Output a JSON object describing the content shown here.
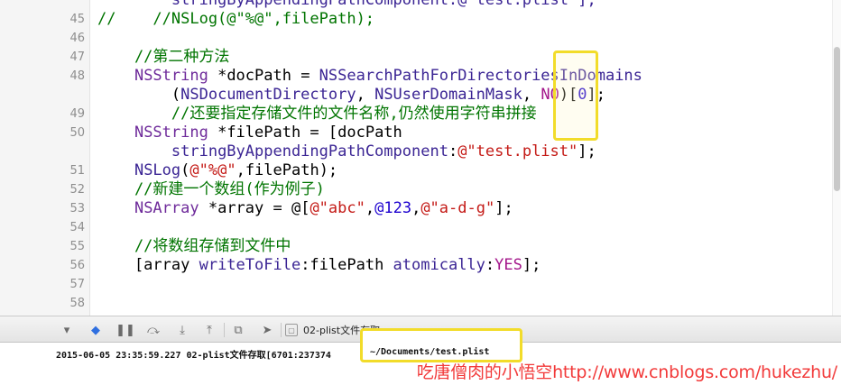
{
  "editor": {
    "lines": [
      {
        "num": "",
        "tokens": [
          {
            "t": "        stringByAppendingPathComponent:@\"test.plist\"];",
            "c": "kw-fn"
          }
        ]
      },
      {
        "num": "45",
        "tokens": [
          {
            "t": "//    //NSLog(@\"%@\",filePath);",
            "c": "kw-comment"
          }
        ]
      },
      {
        "num": "46",
        "tokens": []
      },
      {
        "num": "47",
        "tokens": [
          {
            "t": "    //第二种方法",
            "c": "kw-comment"
          }
        ]
      },
      {
        "num": "48",
        "tokens": [
          {
            "t": "    ",
            "c": "kw-plain"
          },
          {
            "t": "NSString",
            "c": "kw-type"
          },
          {
            "t": " *docPath = ",
            "c": "kw-plain"
          },
          {
            "t": "NSSearchPathForDirectoriesInDomains",
            "c": "kw-fn"
          }
        ]
      },
      {
        "num": "",
        "tokens": [
          {
            "t": "        (",
            "c": "kw-plain"
          },
          {
            "t": "NSDocumentDirectory",
            "c": "kw-fn"
          },
          {
            "t": ", ",
            "c": "kw-plain"
          },
          {
            "t": "NSUserDomainMask",
            "c": "kw-fn"
          },
          {
            "t": ", ",
            "c": "kw-plain"
          },
          {
            "t": "NO",
            "c": "kw-const"
          },
          {
            "t": ")[",
            "c": "kw-plain"
          },
          {
            "t": "0",
            "c": "kw-num"
          },
          {
            "t": "];",
            "c": "kw-plain"
          }
        ]
      },
      {
        "num": "49",
        "tokens": [
          {
            "t": "        //还要指定存储文件的文件名称,仍然使用字符串拼接",
            "c": "kw-comment"
          }
        ]
      },
      {
        "num": "50",
        "tokens": [
          {
            "t": "    ",
            "c": "kw-plain"
          },
          {
            "t": "NSString",
            "c": "kw-type"
          },
          {
            "t": " *filePath = [docPath",
            "c": "kw-plain"
          }
        ]
      },
      {
        "num": "",
        "tokens": [
          {
            "t": "        ",
            "c": "kw-plain"
          },
          {
            "t": "stringByAppendingPathComponent",
            "c": "kw-fn"
          },
          {
            "t": ":",
            "c": "kw-plain"
          },
          {
            "t": "@\"test.plist\"",
            "c": "kw-str"
          },
          {
            "t": "];",
            "c": "kw-plain"
          }
        ]
      },
      {
        "num": "51",
        "tokens": [
          {
            "t": "    ",
            "c": "kw-plain"
          },
          {
            "t": "NSLog",
            "c": "kw-fn"
          },
          {
            "t": "(",
            "c": "kw-plain"
          },
          {
            "t": "@\"%@\"",
            "c": "kw-str"
          },
          {
            "t": ",filePath);",
            "c": "kw-plain"
          }
        ]
      },
      {
        "num": "52",
        "tokens": [
          {
            "t": "    //新建一个数组(作为例子)",
            "c": "kw-comment"
          }
        ]
      },
      {
        "num": "53",
        "tokens": [
          {
            "t": "    ",
            "c": "kw-plain"
          },
          {
            "t": "NSArray",
            "c": "kw-type"
          },
          {
            "t": " *array = @[",
            "c": "kw-plain"
          },
          {
            "t": "@\"abc\"",
            "c": "kw-str"
          },
          {
            "t": ",",
            "c": "kw-plain"
          },
          {
            "t": "@123",
            "c": "kw-num"
          },
          {
            "t": ",",
            "c": "kw-plain"
          },
          {
            "t": "@\"a-d-g\"",
            "c": "kw-str"
          },
          {
            "t": "];",
            "c": "kw-plain"
          }
        ]
      },
      {
        "num": "54",
        "tokens": []
      },
      {
        "num": "55",
        "tokens": [
          {
            "t": "    //将数组存储到文件中",
            "c": "kw-comment"
          }
        ]
      },
      {
        "num": "56",
        "tokens": [
          {
            "t": "    [array ",
            "c": "kw-plain"
          },
          {
            "t": "writeToFile",
            "c": "kw-fn"
          },
          {
            "t": ":filePath ",
            "c": "kw-plain"
          },
          {
            "t": "atomically",
            "c": "kw-fn"
          },
          {
            "t": ":",
            "c": "kw-plain"
          },
          {
            "t": "YES",
            "c": "kw-const"
          },
          {
            "t": "];",
            "c": "kw-plain"
          }
        ]
      },
      {
        "num": "57",
        "tokens": []
      },
      {
        "num": "58",
        "tokens": []
      }
    ]
  },
  "toolbar": {
    "hide_console_icon": "▾",
    "breakpoint_icon": "◆",
    "pause_icon": "❚❚",
    "step_over_icon": "⤼",
    "step_into_icon": "⤓",
    "step_out_icon": "⤒",
    "view_debugger_icon": "⧉",
    "location_icon": "➤",
    "crumb_label": "02-plist文件存取"
  },
  "console": {
    "log_prefix": "2015-06-05 23:35:59.227 02-plist文件存取[6701:237374",
    "log_path": "~/Documents/test.plist"
  },
  "watermark": "吃唐僧肉的小悟空http://www.cnblogs.com/hukezhu/"
}
